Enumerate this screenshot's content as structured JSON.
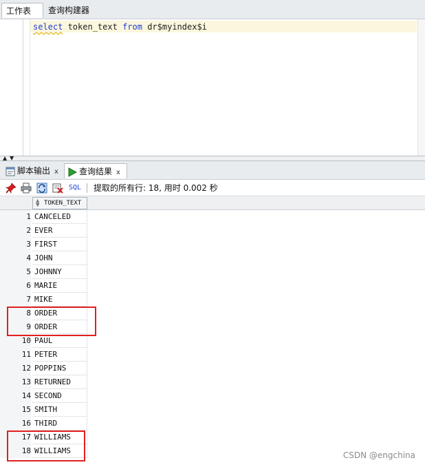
{
  "top_tabs": [
    {
      "label": "工作表",
      "active": true
    },
    {
      "label": "查询构建器",
      "active": false
    }
  ],
  "editor": {
    "code": {
      "kw_select": "select",
      "col": " token_text ",
      "kw_from": "from",
      "table": " dr$myindex$i"
    }
  },
  "output_tabs": [
    {
      "label": "脚本输出",
      "close": "x",
      "icon": "script-output-icon"
    },
    {
      "label": "查询结果",
      "close": "x",
      "icon": "play-icon",
      "active": true
    }
  ],
  "toolbar": {
    "icons": [
      "pin-icon",
      "print-icon",
      "refresh-icon",
      "delete-icon"
    ],
    "sql_label": "SQL",
    "status": "提取的所有行: 18, 用时 0.002 秒"
  },
  "grid": {
    "column_header": "TOKEN_TEXT",
    "rows": [
      {
        "num": "1",
        "value": "CANCELED"
      },
      {
        "num": "2",
        "value": "EVER"
      },
      {
        "num": "3",
        "value": "FIRST"
      },
      {
        "num": "4",
        "value": "JOHN"
      },
      {
        "num": "5",
        "value": "JOHNNY"
      },
      {
        "num": "6",
        "value": "MARIE"
      },
      {
        "num": "7",
        "value": "MIKE"
      },
      {
        "num": "8",
        "value": "ORDER"
      },
      {
        "num": "9",
        "value": "ORDER"
      },
      {
        "num": "10",
        "value": "PAUL"
      },
      {
        "num": "11",
        "value": "PETER"
      },
      {
        "num": "12",
        "value": "POPPINS"
      },
      {
        "num": "13",
        "value": "RETURNED"
      },
      {
        "num": "14",
        "value": "SECOND"
      },
      {
        "num": "15",
        "value": "SMITH"
      },
      {
        "num": "16",
        "value": "THIRD"
      },
      {
        "num": "17",
        "value": "WILLIAMS"
      },
      {
        "num": "18",
        "value": "WILLIAMS"
      }
    ]
  },
  "colors": {
    "highlight": "#e21e1e",
    "keyword": "#1c3fd0"
  },
  "watermark": "CSDN @engchina"
}
